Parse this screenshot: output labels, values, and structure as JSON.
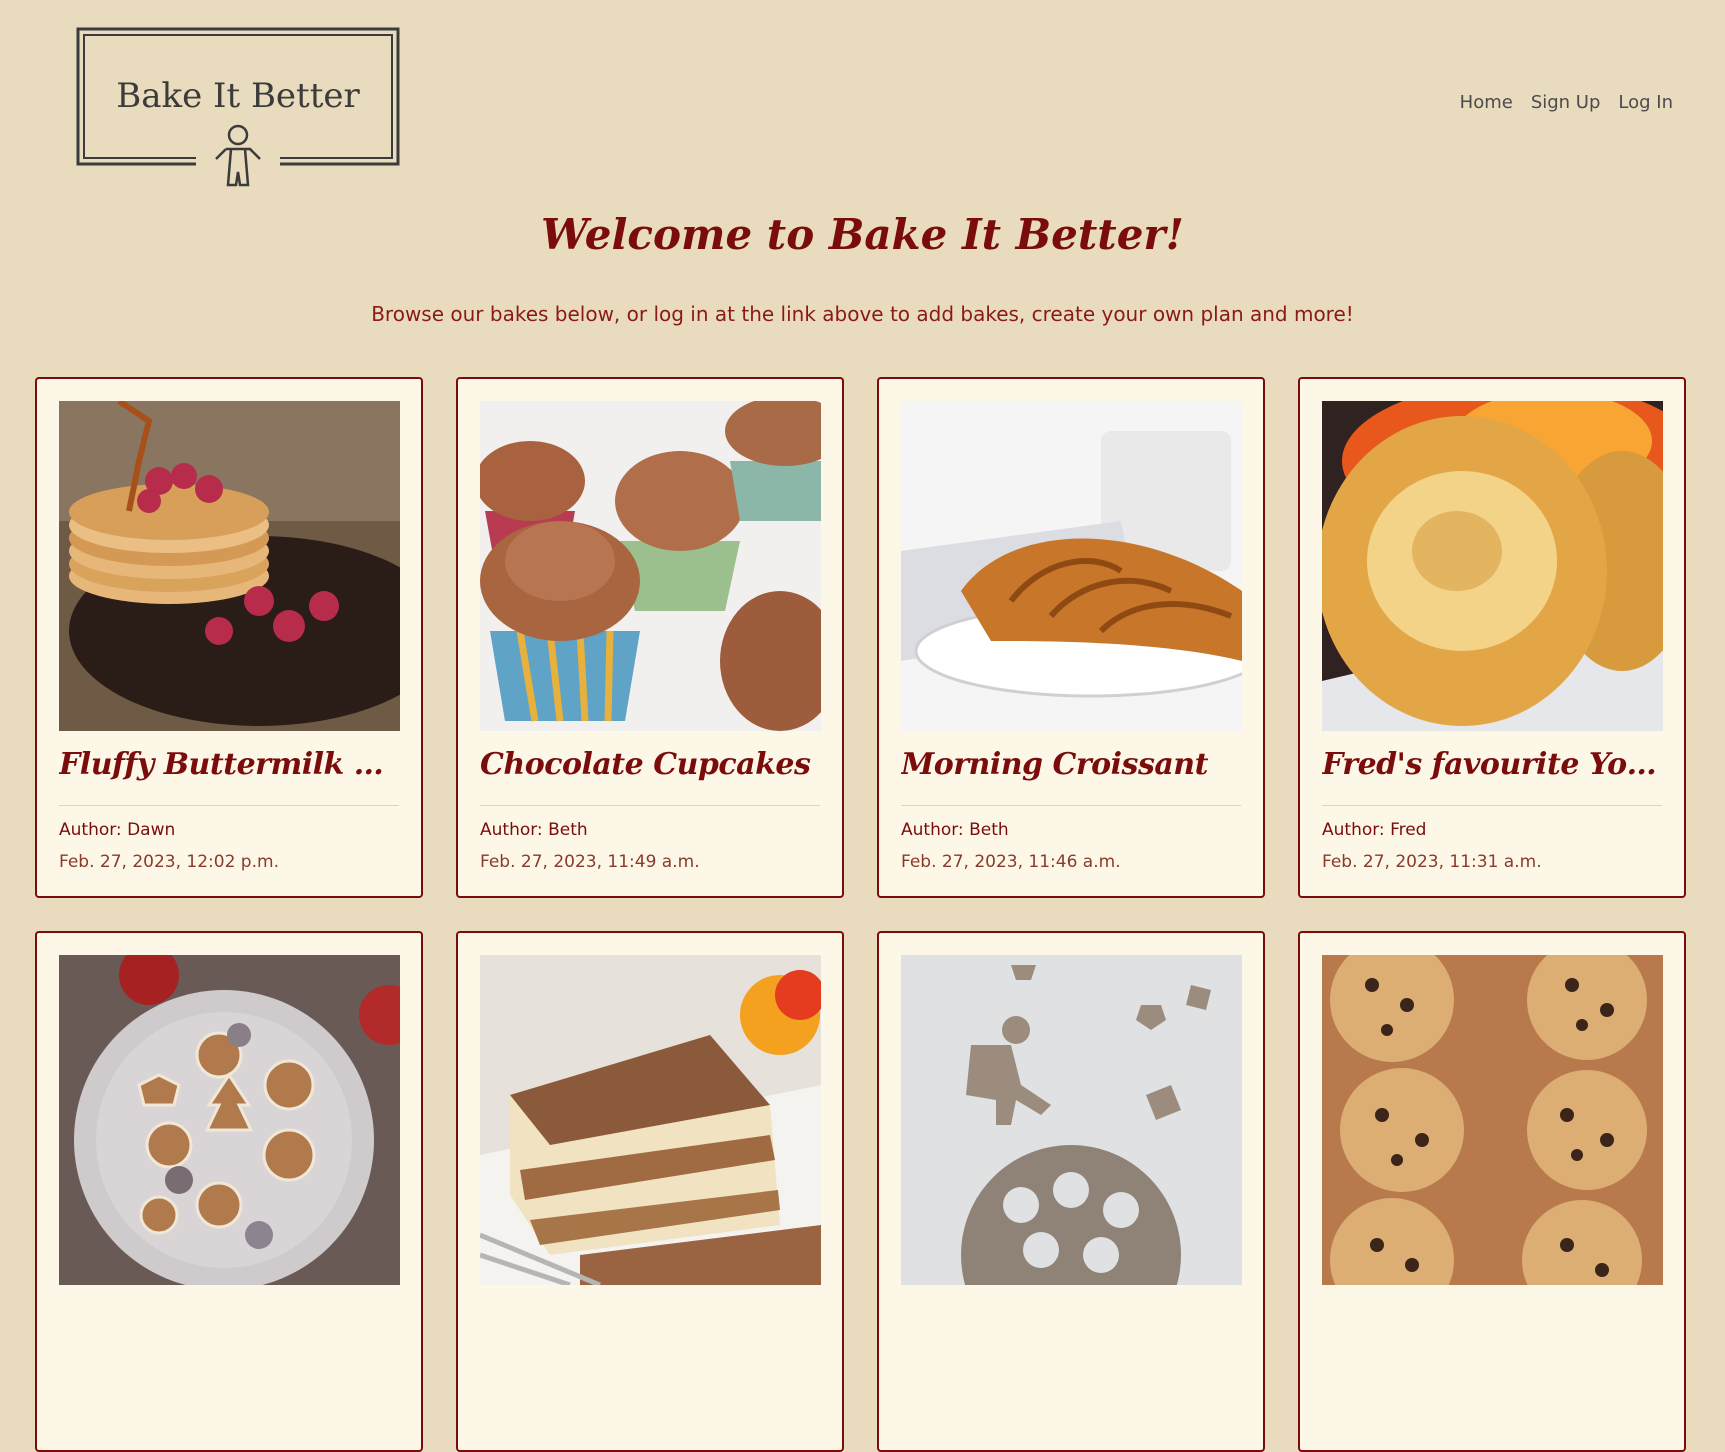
{
  "brand": {
    "name": "Bake It Better"
  },
  "nav": {
    "items": [
      "Home",
      "Sign Up",
      "Log In"
    ]
  },
  "hero": {
    "title": "Welcome to Bake It Better!",
    "subtitle": "Browse our bakes below, or log in at the link above to add bakes, create your own plan and more!"
  },
  "bakes": [
    {
      "title": "Fluffy Buttermilk Panc...",
      "author": "Author: Dawn",
      "date": "Feb. 27, 2023, 12:02 p.m.",
      "image": "pancakes-with-raspberries"
    },
    {
      "title": "Chocolate Cupcakes",
      "author": "Author: Beth",
      "date": "Feb. 27, 2023, 11:49 a.m.",
      "image": "chocolate-cupcakes"
    },
    {
      "title": "Morning Croissant",
      "author": "Author: Beth",
      "date": "Feb. 27, 2023, 11:46 a.m.",
      "image": "croissant-on-plate"
    },
    {
      "title": "Fred's favourite Yorksh...",
      "author": "Author: Fred",
      "date": "Feb. 27, 2023, 11:31 a.m.",
      "image": "yorkshire-pudding"
    },
    {
      "image": "gingerbread-cookies-plate"
    },
    {
      "image": "tiramisu-slice"
    },
    {
      "image": "cookie-dough-cutouts"
    },
    {
      "image": "chocolate-chip-cookies"
    }
  ],
  "colors": {
    "background": "#e9dcbe",
    "card": "#fdf7e7",
    "accent": "#7a0c0c",
    "nav_text": "#4b4b4b"
  }
}
